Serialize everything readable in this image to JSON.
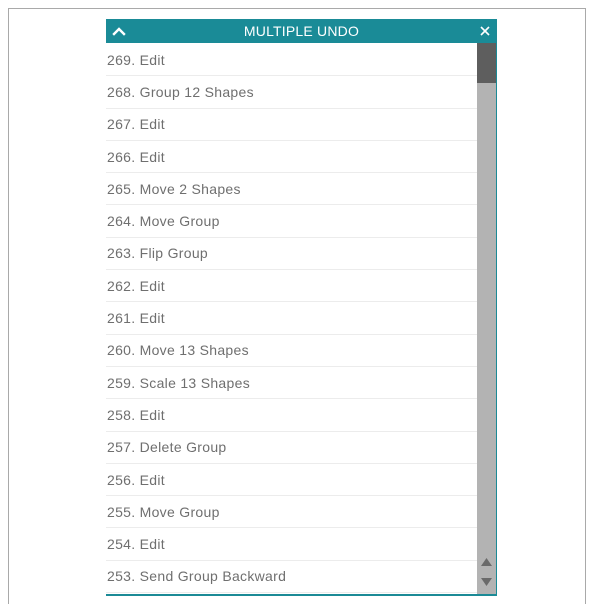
{
  "panel": {
    "title": "MULTIPLE UNDO",
    "collapse_icon": "chevron-up-icon",
    "close_icon": "close-icon"
  },
  "history": [
    {
      "label": "269. Edit"
    },
    {
      "label": "268. Group 12 Shapes"
    },
    {
      "label": "267. Edit"
    },
    {
      "label": "266. Edit"
    },
    {
      "label": "265. Move 2 Shapes"
    },
    {
      "label": "264. Move Group"
    },
    {
      "label": "263. Flip Group"
    },
    {
      "label": "262. Edit"
    },
    {
      "label": "261. Edit"
    },
    {
      "label": "260. Move 13 Shapes"
    },
    {
      "label": "259. Scale 13 Shapes"
    },
    {
      "label": "258. Edit"
    },
    {
      "label": "257. Delete Group"
    },
    {
      "label": "256. Edit"
    },
    {
      "label": "255. Move Group"
    },
    {
      "label": "254. Edit"
    },
    {
      "label": "253. Send Group Backward"
    }
  ],
  "colors": {
    "titlebar": "#1a8b97",
    "text": "#6f6f6f",
    "scroll_track": "#b3b3b3",
    "scroll_thumb": "#5e5e5e"
  }
}
